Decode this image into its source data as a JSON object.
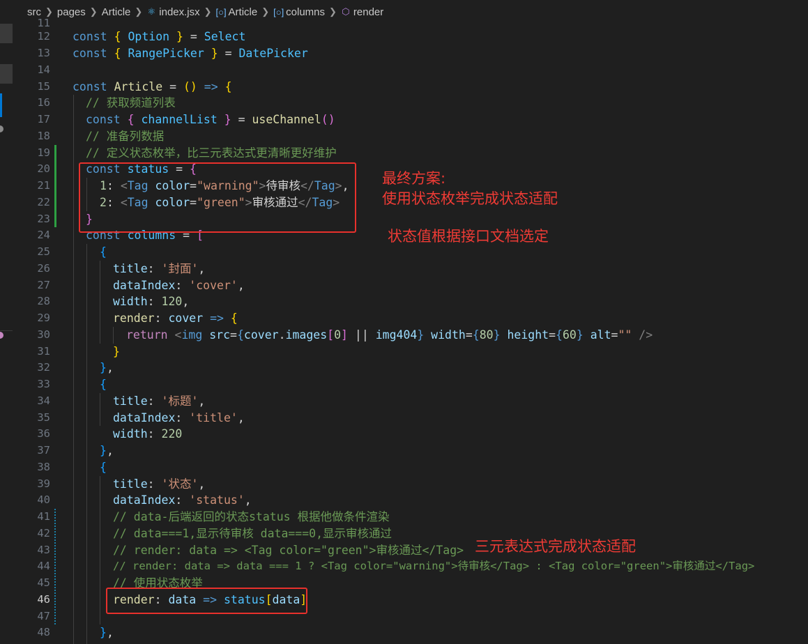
{
  "breadcrumb": {
    "items": [
      {
        "label": "src",
        "icon": ""
      },
      {
        "label": "pages",
        "icon": ""
      },
      {
        "label": "Article",
        "icon": ""
      },
      {
        "label": "index.jsx",
        "icon": "react-icon"
      },
      {
        "label": "Article",
        "icon": "symbol-variable-icon"
      },
      {
        "label": "columns",
        "icon": "symbol-variable-icon"
      },
      {
        "label": "render",
        "icon": "symbol-method-icon"
      }
    ]
  },
  "editor": {
    "line_numbers": [
      "11",
      "12",
      "13",
      "14",
      "15",
      "16",
      "17",
      "18",
      "19",
      "20",
      "21",
      "22",
      "23",
      "24",
      "25",
      "26",
      "27",
      "28",
      "29",
      "30",
      "31",
      "32",
      "33",
      "34",
      "35",
      "36",
      "37",
      "38",
      "39",
      "40",
      "41",
      "42",
      "43",
      "44",
      "45",
      "46",
      "47",
      "48"
    ],
    "active_line": "46",
    "lines": {
      "l12": {
        "t1": "const ",
        "t2": "{ ",
        "t3": "Option",
        "t4": " }",
        "t5": " = ",
        "t6": "Select"
      },
      "l13": {
        "t1": "const ",
        "t2": "{ ",
        "t3": "RangePicker",
        "t4": " }",
        "t5": " = ",
        "t6": "DatePicker"
      },
      "l15": {
        "t1": "const ",
        "t2": "Article",
        "t3": " = ",
        "t4": "()",
        "t5": " => ",
        "t6": "{"
      },
      "l16": {
        "t1": "// 获取频道列表"
      },
      "l17": {
        "t1": "const ",
        "t2": "{ ",
        "t3": "channelList",
        "t4": " }",
        "t5": " = ",
        "t6": "useChannel",
        "t7": "()"
      },
      "l18": {
        "t1": "// 准备列数据"
      },
      "l19": {
        "t1": "// 定义状态枚举，比三元表达式更清晰更好维护"
      },
      "l20": {
        "t1": "const ",
        "t2": "status",
        "t3": " = ",
        "t4": "{"
      },
      "l21": {
        "t1": "1",
        "t2": ": ",
        "t3": "<",
        "t4": "Tag",
        "t5": " color",
        "t6": "=",
        "t7": "\"warning\"",
        "t8": ">",
        "t9": "待审核",
        "t10": "</",
        "t11": "Tag",
        "t12": ">",
        "t13": ","
      },
      "l22": {
        "t1": "2",
        "t2": ": ",
        "t3": "<",
        "t4": "Tag",
        "t5": " color",
        "t6": "=",
        "t7": "\"green\"",
        "t8": ">",
        "t9": "审核通过",
        "t10": "</",
        "t11": "Tag",
        "t12": ">"
      },
      "l23": {
        "t1": "}"
      },
      "l24": {
        "t1": "const ",
        "t2": "columns",
        "t3": " = ",
        "t4": "["
      },
      "l25": {
        "t1": "{"
      },
      "l26": {
        "t1": "title",
        "t2": ": ",
        "t3": "'封面'",
        "t4": ","
      },
      "l27": {
        "t1": "dataIndex",
        "t2": ": ",
        "t3": "'cover'",
        "t4": ","
      },
      "l28": {
        "t1": "width",
        "t2": ": ",
        "t3": "120",
        "t4": ","
      },
      "l29": {
        "t1": "render",
        "t2": ": ",
        "t3": "cover",
        "t4": " => ",
        "t5": "{"
      },
      "l30": {
        "t1": "return ",
        "t2": "<",
        "t3": "img",
        "t4": " src",
        "t5": "=",
        "t6": "{",
        "t7": "cover",
        "t8": ".",
        "t9": "images",
        "t10": "[",
        "t11": "0",
        "t12": "]",
        "t13": " || ",
        "t14": "img404",
        "t15": "}",
        "t16": " width",
        "t17": "=",
        "t18": "{",
        "t19": "80",
        "t20": "}",
        "t21": " height",
        "t22": "=",
        "t23": "{",
        "t24": "60",
        "t25": "}",
        "t26": " alt",
        "t27": "=",
        "t28": "\"\"",
        "t29": " />"
      },
      "l31": {
        "t1": "}"
      },
      "l32": {
        "t1": "}",
        "t2": ","
      },
      "l33": {
        "t1": "{"
      },
      "l34": {
        "t1": "title",
        "t2": ": ",
        "t3": "'标题'",
        "t4": ","
      },
      "l35": {
        "t1": "dataIndex",
        "t2": ": ",
        "t3": "'title'",
        "t4": ","
      },
      "l36": {
        "t1": "width",
        "t2": ": ",
        "t3": "220"
      },
      "l37": {
        "t1": "}",
        "t2": ","
      },
      "l38": {
        "t1": "{"
      },
      "l39": {
        "t1": "title",
        "t2": ": ",
        "t3": "'状态'",
        "t4": ","
      },
      "l40": {
        "t1": "dataIndex",
        "t2": ": ",
        "t3": "'status'",
        "t4": ","
      },
      "l41": {
        "t1": "// data-后端返回的状态status 根据他做条件渲染"
      },
      "l42": {
        "t1": "// data===1,显示待审核 data===0,显示审核通过"
      },
      "l43": {
        "t1": "// render: data => <Tag color=\"green\">审核通过</Tag>"
      },
      "l44": {
        "t1": "// render: data => data === 1 ? <Tag color=\"warning\">待审核</Tag> : <Tag color=\"green\">审核通过</Tag>"
      },
      "l45": {
        "t1": "// 使用状态枚举"
      },
      "l46": {
        "t1": "render",
        "t2": ": ",
        "t3": "data",
        "t4": " => ",
        "t5": "status",
        "t6": "[",
        "t7": "data",
        "t8": "]"
      },
      "l48": {
        "t1": "}",
        "t2": ","
      }
    }
  },
  "annotations": {
    "final_title": "最终方案:",
    "final_desc": "使用状态枚举完成状态适配",
    "status_note": "状态值根据接口文档选定",
    "ternary_note": "三元表达式完成状态适配"
  },
  "colors": {
    "background": "#1f1f1f",
    "annotation_red": "#e8312c",
    "keyword": "#569cd6",
    "comment": "#6a9955",
    "string": "#ce9178"
  }
}
